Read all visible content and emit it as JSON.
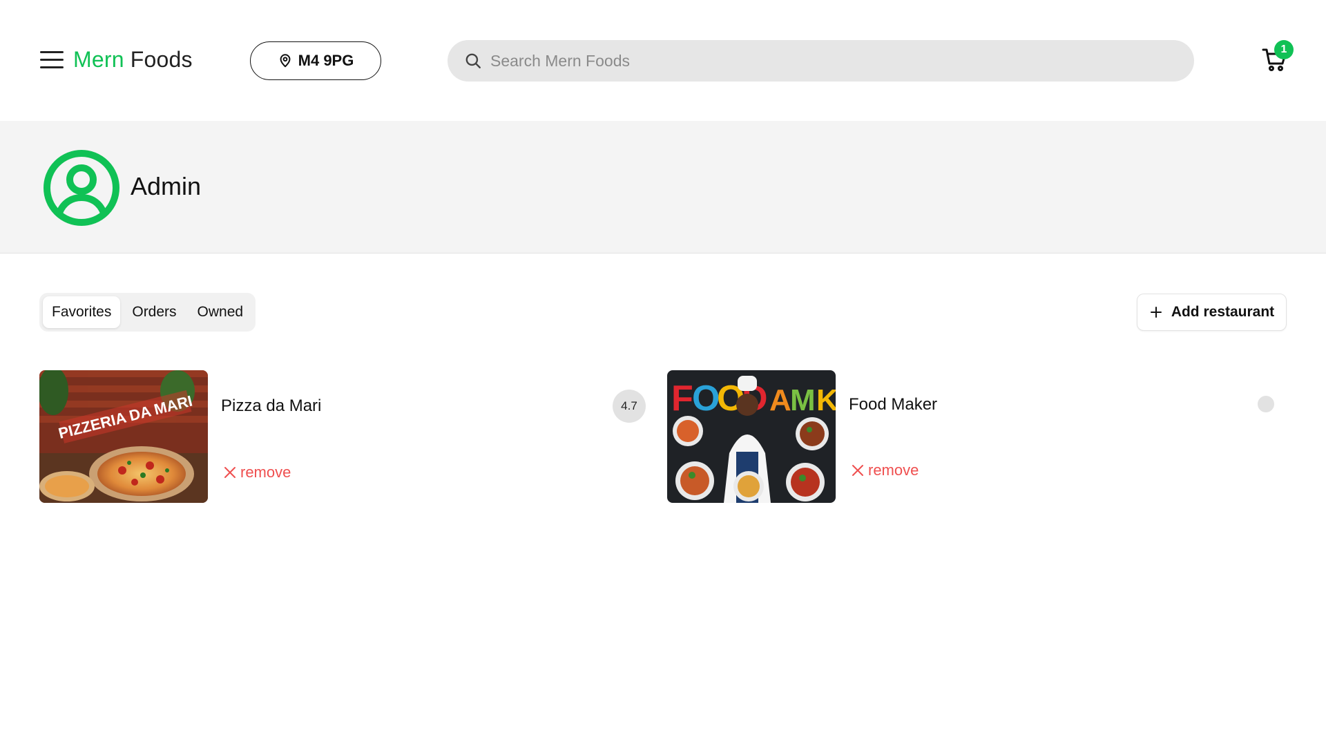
{
  "header": {
    "logo_brand": "Mern",
    "logo_rest": " Foods",
    "location": "M4 9PG",
    "search_placeholder": "Search Mern Foods",
    "cart_count": "1"
  },
  "profile": {
    "name": "Admin"
  },
  "tabs": [
    {
      "label": "Favorites",
      "active": true
    },
    {
      "label": "Orders",
      "active": false
    },
    {
      "label": "Owned",
      "active": false
    }
  ],
  "add_button_label": "Add restaurant",
  "favorites": [
    {
      "name": "Pizza da Mari",
      "rating": "4.7",
      "remove_label": "remove",
      "image": "pizzeria-photo"
    },
    {
      "name": "Food Maker",
      "rating": "",
      "remove_label": "remove",
      "image": "chef-food-photo"
    }
  ],
  "colors": {
    "brand": "#10c155",
    "danger": "#ef4f4f",
    "band": "#f4f4f4",
    "search_bg": "#e6e6e6"
  }
}
